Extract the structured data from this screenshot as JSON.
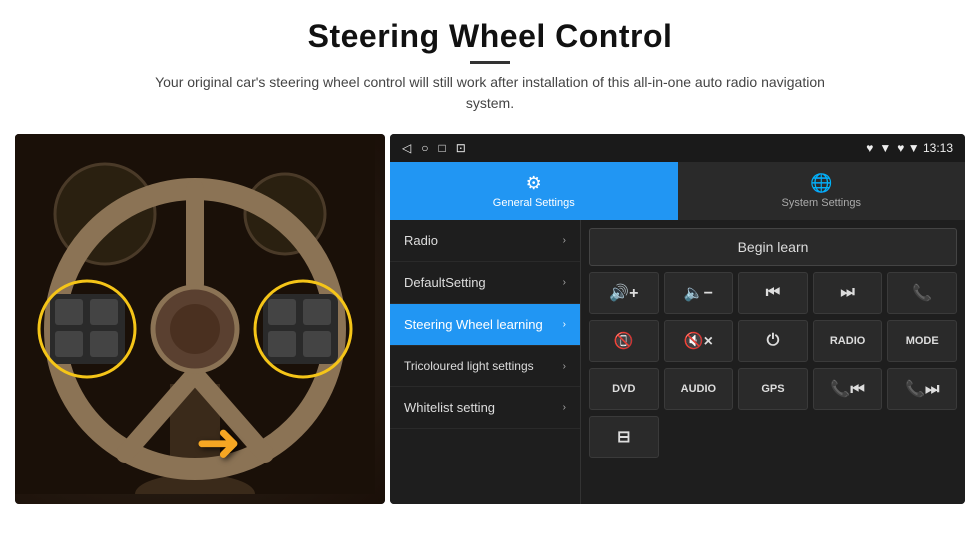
{
  "header": {
    "title": "Steering Wheel Control",
    "subtitle": "Your original car's steering wheel control will still work after installation of this all-in-one auto radio navigation system."
  },
  "status_bar": {
    "icons": [
      "◁",
      "○",
      "□",
      "⊡"
    ],
    "right": "♥ ▼ 13:13"
  },
  "tabs": [
    {
      "id": "general",
      "label": "General Settings",
      "icon": "⚙",
      "active": true
    },
    {
      "id": "system",
      "label": "System Settings",
      "icon": "🌐",
      "active": false
    }
  ],
  "menu_items": [
    {
      "id": "radio",
      "label": "Radio",
      "active": false
    },
    {
      "id": "default",
      "label": "DefaultSetting",
      "active": false
    },
    {
      "id": "steering",
      "label": "Steering Wheel learning",
      "active": true
    },
    {
      "id": "tricoloured",
      "label": "Tricoloured light settings",
      "active": false
    },
    {
      "id": "whitelist",
      "label": "Whitelist setting",
      "active": false
    }
  ],
  "controls": {
    "begin_learn_label": "Begin learn",
    "buttons_row1": [
      {
        "id": "vol-up",
        "label": "🔊+",
        "type": "icon"
      },
      {
        "id": "vol-down",
        "label": "🔈-",
        "type": "icon"
      },
      {
        "id": "prev",
        "label": "⏮",
        "type": "icon"
      },
      {
        "id": "next",
        "label": "⏭",
        "type": "icon"
      },
      {
        "id": "phone",
        "label": "📞",
        "type": "icon"
      }
    ],
    "buttons_row2": [
      {
        "id": "hang-up",
        "label": "📵",
        "type": "icon"
      },
      {
        "id": "mute",
        "label": "🔇×",
        "type": "icon"
      },
      {
        "id": "power",
        "label": "⏻",
        "type": "icon"
      },
      {
        "id": "radio-btn",
        "label": "RADIO",
        "type": "text"
      },
      {
        "id": "mode-btn",
        "label": "MODE",
        "type": "text"
      }
    ],
    "buttons_row3": [
      {
        "id": "dvd-btn",
        "label": "DVD",
        "type": "text"
      },
      {
        "id": "audio-btn",
        "label": "AUDIO",
        "type": "text"
      },
      {
        "id": "gps-btn",
        "label": "GPS",
        "type": "text"
      },
      {
        "id": "phone-prev",
        "label": "📞⏮",
        "type": "icon"
      },
      {
        "id": "phone-next",
        "label": "📞⏭",
        "type": "icon"
      }
    ],
    "buttons_row4": [
      {
        "id": "special",
        "label": "⊟",
        "type": "icon"
      }
    ]
  }
}
